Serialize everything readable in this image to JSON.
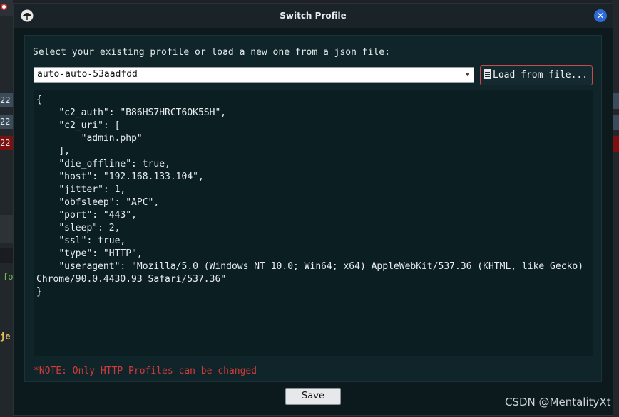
{
  "window": {
    "title": "Switch Profile"
  },
  "panel": {
    "prompt": "Select your existing profile or load a new one from a json file:",
    "profile_select": {
      "selected": "auto-auto-53aadfdd"
    },
    "load_button_label": "Load from file...",
    "editor_text": "{\n    \"c2_auth\": \"B86HS7HRCT6OK5SH\",\n    \"c2_uri\": [\n        \"admin.php\"\n    ],\n    \"die_offline\": true,\n    \"host\": \"192.168.133.104\",\n    \"jitter\": 1,\n    \"obfsleep\": \"APC\",\n    \"port\": \"443\",\n    \"sleep\": 2,\n    \"ssl\": true,\n    \"type\": \"HTTP\",\n    \"useragent\": \"Mozilla/5.0 (Windows NT 10.0; Win64; x64) AppleWebKit/537.36 (KHTML, like Gecko) Chrome/90.0.4430.93 Safari/537.36\"\n}",
    "note": "*NOTE: Only HTTP Profiles can be changed"
  },
  "footer": {
    "save_label": "Save"
  },
  "background": {
    "rows": [
      "22",
      "22",
      "22",
      "fo",
      "je"
    ]
  },
  "watermark": "CSDN @MentalityXt",
  "icons": {
    "app": "umbrella-icon",
    "close": "close-icon",
    "load": "document-icon",
    "dropdown": "chevron-down-icon"
  },
  "colors": {
    "accent_close": "#2e6ad8",
    "note": "#d23a3a",
    "load_border": "#c84a4a"
  }
}
